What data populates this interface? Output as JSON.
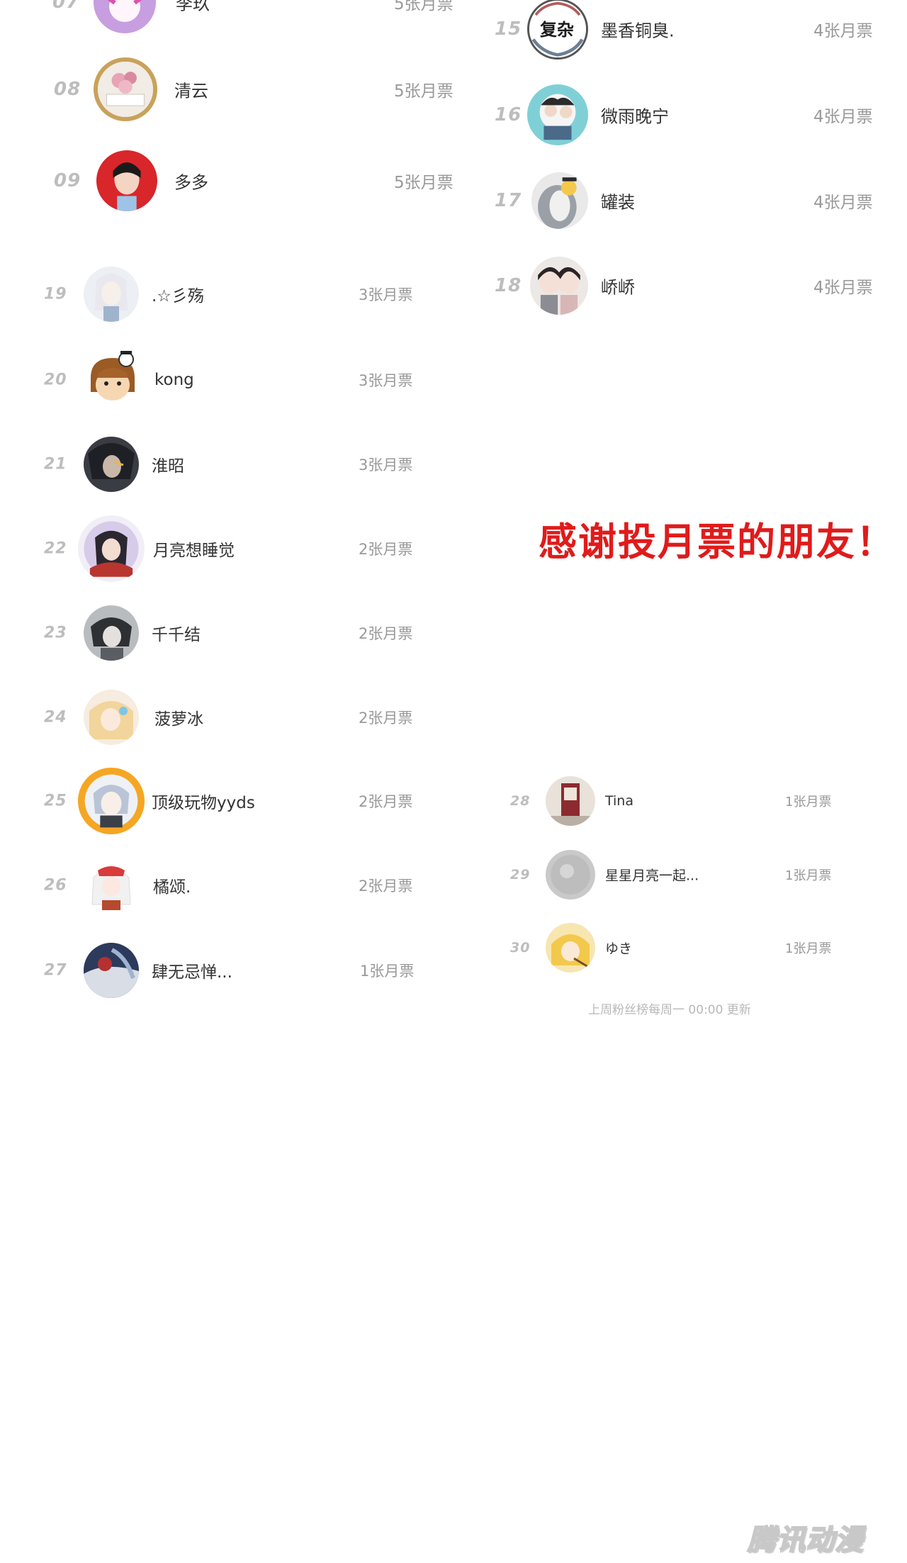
{
  "left_top": [
    {
      "rank": "07",
      "name": "李玖",
      "votes": "5张月票"
    },
    {
      "rank": "08",
      "name": "清云",
      "votes": "5张月票"
    },
    {
      "rank": "09",
      "name": "多多",
      "votes": "5张月票"
    }
  ],
  "right_top": [
    {
      "rank": "15",
      "name": "墨香铜臭.",
      "votes": "4张月票",
      "avatar_text": "复杂"
    },
    {
      "rank": "16",
      "name": "微雨晚宁",
      "votes": "4张月票"
    },
    {
      "rank": "17",
      "name": "罐装",
      "votes": "4张月票"
    },
    {
      "rank": "18",
      "name": "峤峤",
      "votes": "4张月票"
    }
  ],
  "left_list": [
    {
      "rank": "19",
      "name": ".☆彡殇",
      "votes": "3张月票"
    },
    {
      "rank": "20",
      "name": "kong",
      "votes": "3张月票"
    },
    {
      "rank": "21",
      "name": "淮昭",
      "votes": "3张月票"
    },
    {
      "rank": "22",
      "name": "月亮想睡觉",
      "votes": "2张月票"
    },
    {
      "rank": "23",
      "name": "千千结",
      "votes": "2张月票"
    },
    {
      "rank": "24",
      "name": "菠萝冰",
      "votes": "2张月票"
    },
    {
      "rank": "25",
      "name": "顶级玩物yyds",
      "votes": "2张月票"
    },
    {
      "rank": "26",
      "name": "橘颂.",
      "votes": "2张月票"
    },
    {
      "rank": "27",
      "name": "肆无忌惮...",
      "votes": "1张月票"
    }
  ],
  "right_list": [
    {
      "rank": "28",
      "name": "Tina",
      "votes": "1张月票"
    },
    {
      "rank": "29",
      "name": "星星月亮一起...",
      "votes": "1张月票"
    },
    {
      "rank": "30",
      "name": "ゆき",
      "votes": "1张月票"
    }
  ],
  "thanks_text": "感谢投月票的朋友！",
  "footnote": "上周粉丝榜每周一 00:00 更新",
  "watermark": "腾讯动漫",
  "colors": {
    "thanks": "#e01b1b",
    "rank": "#bdbdbd",
    "name": "#333333",
    "votes": "#999999"
  }
}
